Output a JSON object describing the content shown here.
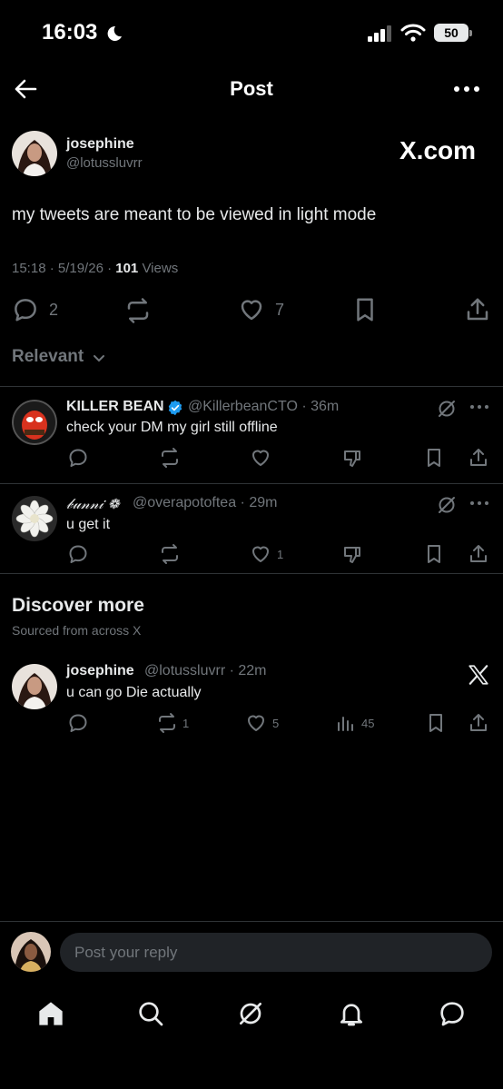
{
  "status_bar": {
    "time": "16:03",
    "battery": "50"
  },
  "header": {
    "title": "Post"
  },
  "main_post": {
    "name": "josephine",
    "handle": "@lotussluvrr",
    "brand": "X.com",
    "text": "my tweets are meant to be viewed in light mode",
    "meta_time": "15:18 · 5/19/26 · ",
    "views_count": "101",
    "views_label": " Views",
    "replies": "2",
    "likes": "7"
  },
  "sort": {
    "label": "Relevant"
  },
  "replies": [
    {
      "name": "KILLER BEAN",
      "handle": "@KillerbeanCTO · 36m",
      "text": "check your DM my girl still offline",
      "likes": ""
    },
    {
      "name": "𝒷𝓊𝓃𝓃𝒾 ❁",
      "handle": "@overapotoftea · 29m",
      "text": "u get it",
      "likes": "1"
    }
  ],
  "discover": {
    "title": "Discover more",
    "subtitle": "Sourced from across X",
    "post": {
      "name": "josephine",
      "handle": "@lotussluvrr · 22m",
      "text": "u can go Die actually",
      "reposts": "1",
      "likes": "5",
      "views": "45"
    }
  },
  "reply_input": {
    "placeholder": "Post your reply"
  },
  "colors": {
    "background": "#000000",
    "text": "#e7e9ea",
    "muted": "#71767b",
    "verified": "#1d9bf0",
    "divider": "#2f3336"
  }
}
